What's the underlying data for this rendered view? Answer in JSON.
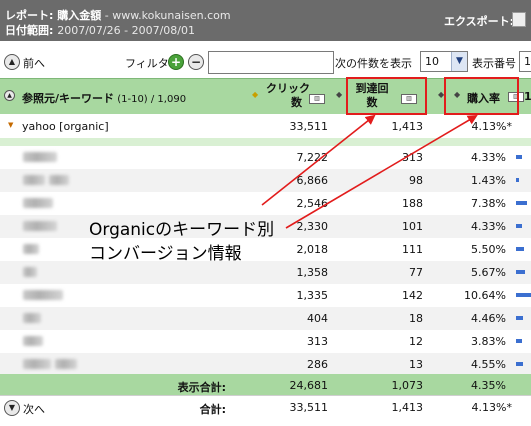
{
  "header": {
    "report_label": "レポート: 購入金額",
    "site": " - www.kokunaisen.com",
    "date_label": "日付範囲: ",
    "date_range": "2007/07/26 - 2007/08/01",
    "export_label": "エクスポート:"
  },
  "toolbar": {
    "prev_label": "前へ",
    "filter_label": "フィルタ",
    "filter_value": "",
    "show_next_label": "次の件数を表示",
    "count_value": "10",
    "display_number_label": "表示番号",
    "display_number_value": "1"
  },
  "table": {
    "headers": {
      "source_keyword": "参照元/キーワード",
      "range": " (1-10) / 1,090",
      "clicks": "クリック\n数",
      "arrivals": "到達回\n数",
      "purchase_rate": "購入率",
      "next_col": "1"
    },
    "parent_row": {
      "label": "yahoo [organic]",
      "clicks": "33,511",
      "arrivals": "1,413",
      "rate": "4.13%*"
    },
    "rows": [
      {
        "clicks": "7,222",
        "arrivals": "313",
        "rate": "4.33%",
        "bar": 0.43
      },
      {
        "clicks": "6,866",
        "arrivals": "98",
        "rate": "1.43%",
        "bar": 0.14
      },
      {
        "clicks": "2,546",
        "arrivals": "188",
        "rate": "7.38%",
        "bar": 0.74
      },
      {
        "clicks": "2,330",
        "arrivals": "101",
        "rate": "4.33%",
        "bar": 0.43
      },
      {
        "clicks": "2,018",
        "arrivals": "111",
        "rate": "5.50%",
        "bar": 0.55
      },
      {
        "clicks": "1,358",
        "arrivals": "77",
        "rate": "5.67%",
        "bar": 0.57
      },
      {
        "clicks": "1,335",
        "arrivals": "142",
        "rate": "10.64%",
        "bar": 1.0
      },
      {
        "clicks": "404",
        "arrivals": "18",
        "rate": "4.46%",
        "bar": 0.45
      },
      {
        "clicks": "313",
        "arrivals": "12",
        "rate": "3.83%",
        "bar": 0.38
      },
      {
        "clicks": "286",
        "arrivals": "13",
        "rate": "4.55%",
        "bar": 0.46
      }
    ],
    "subtotal": {
      "label": "表示合計:",
      "clicks": "24,681",
      "arrivals": "1,073",
      "rate": "4.35%"
    },
    "total": {
      "next_label": "次へ",
      "label": "合計:",
      "clicks": "33,511",
      "arrivals": "1,413",
      "rate": "4.13%*"
    }
  },
  "annotation": {
    "line1": "Organicのキーワード別",
    "line2": "コンバージョン情報",
    "color": "#e21c1c"
  },
  "colors": {
    "header_bg": "#6b6b6b",
    "table_header_bg": "#a8d8a0",
    "bar": "#3b6fd0"
  }
}
